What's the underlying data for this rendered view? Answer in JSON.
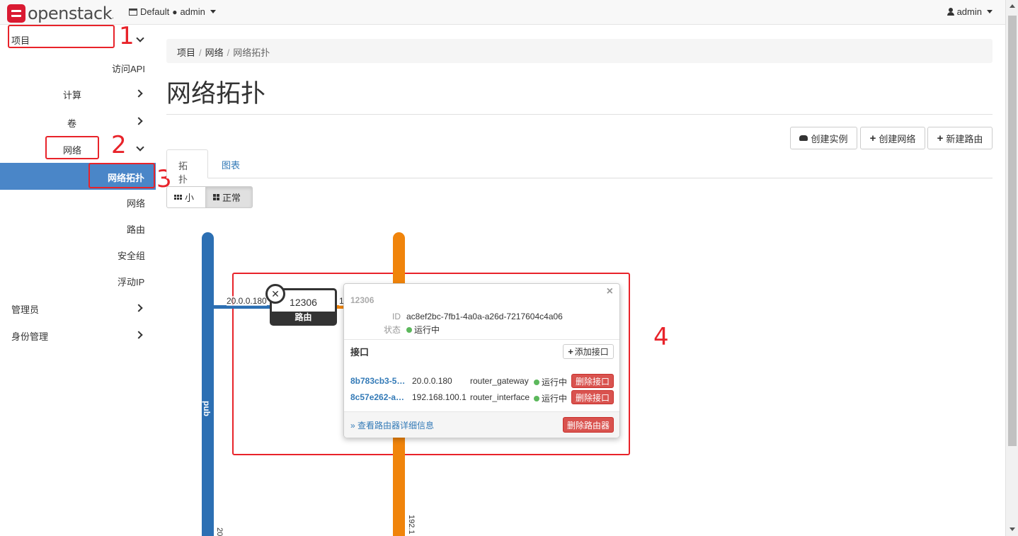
{
  "topbar": {
    "logo_text": "openstack",
    "logo_dot": ".",
    "project_domain": "Default",
    "project_name": "admin",
    "user_name": "admin"
  },
  "sidebar": {
    "project": "项目",
    "access_api": "访问API",
    "compute": "计算",
    "volume": "卷",
    "network": "网络",
    "network_topology": "网络拓扑",
    "networks": "网络",
    "routers": "路由",
    "security_groups": "安全组",
    "floating_ip": "浮动IP",
    "admin": "管理员",
    "identity": "身份管理"
  },
  "annotations": [
    "1",
    "2",
    "3",
    "4"
  ],
  "breadcrumb": [
    "项目",
    "网络",
    "网络拓扑"
  ],
  "page_title": "网络拓扑",
  "actions": {
    "create_instance": "创建实例",
    "create_network": "创建网络",
    "create_router": "新建路由"
  },
  "tabs": [
    "拓扑",
    "图表"
  ],
  "size_toggle": {
    "small": "小",
    "normal": "正常"
  },
  "topology": {
    "networks": [
      {
        "name": "pub",
        "color": "#2c6fb3",
        "cidr_fragment": "20"
      },
      {
        "name": "",
        "color": "#f0840b",
        "cidr_fragment": "192.1"
      }
    ],
    "link_ip": "20.0.0.180",
    "link_ip_fragment": "1",
    "router": {
      "name": "12306",
      "type": "路由"
    }
  },
  "popup": {
    "title": "12306",
    "id_label": "ID",
    "id_value": "ac8ef2bc-7fb1-4a0a-a26d-7217604c4a06",
    "status_label": "状态",
    "status_value": "运行中",
    "interfaces_heading": "接口",
    "add_interface": "添加接口",
    "interfaces": [
      {
        "id": "8b783cb3-5…",
        "ip": "20.0.0.180",
        "type": "router_gateway",
        "status": "运行中",
        "delete": "删除接口"
      },
      {
        "id": "8c57e262-a…",
        "ip": "192.168.100.1",
        "type": "router_interface",
        "status": "运行中",
        "delete": "删除接口"
      }
    ],
    "details_link": "» 查看路由器详细信息",
    "delete_router": "删除路由器"
  },
  "colors": {
    "active_nav": "#4a86c8",
    "annotation_red": "#e8232a",
    "status_green": "#5cb85c",
    "danger": "#d9534f"
  }
}
